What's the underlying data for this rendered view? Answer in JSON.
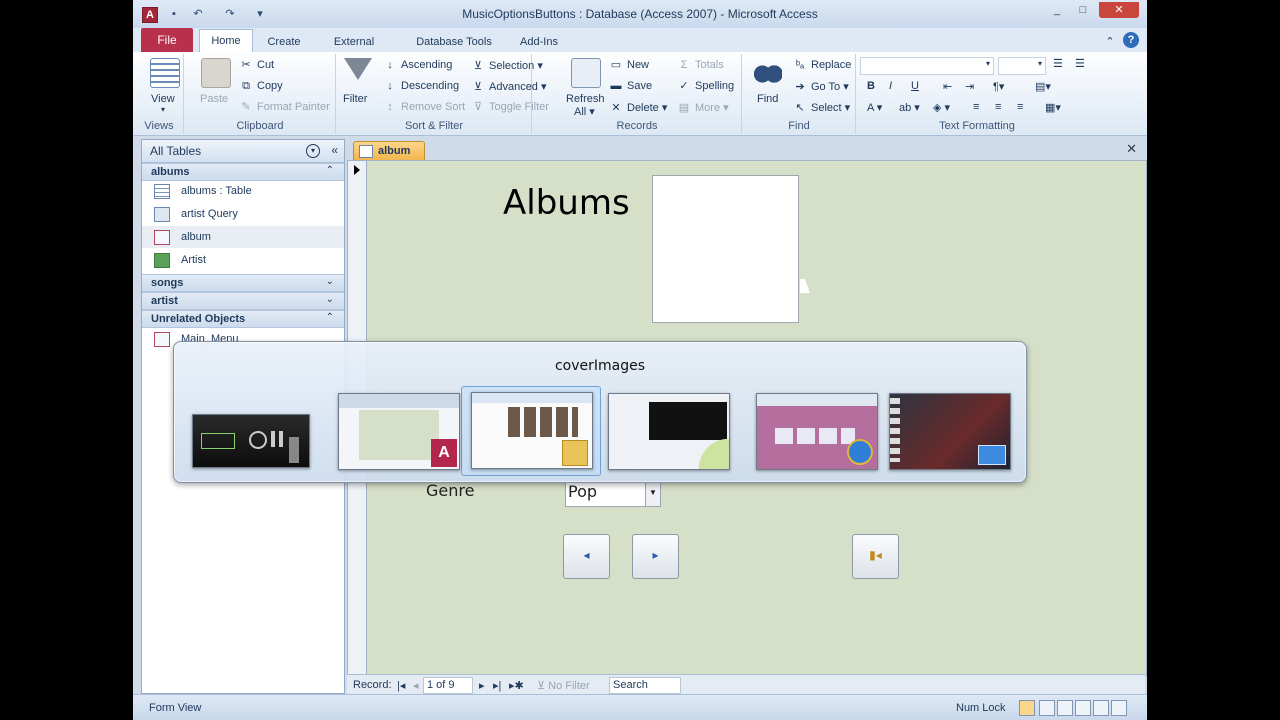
{
  "window": {
    "title": "MusicOptionsButtons : Database (Access 2007) - Microsoft Access",
    "app_letter": "A",
    "controls": [
      "_",
      "□",
      "✕"
    ]
  },
  "tabs": {
    "file": "File",
    "items": [
      "Home",
      "Create",
      "External Data",
      "Database Tools",
      "Add-Ins"
    ],
    "active": "Home"
  },
  "ribbon": {
    "views": {
      "view": "View",
      "label": "Views"
    },
    "clipboard": {
      "paste": "Paste",
      "cut": "Cut",
      "copy": "Copy",
      "format_painter": "Format Painter",
      "label": "Clipboard"
    },
    "sort_filter": {
      "filter": "Filter",
      "ascending": "Ascending",
      "descending": "Descending",
      "remove_sort": "Remove Sort",
      "selection": "Selection",
      "advanced": "Advanced",
      "toggle_filter": "Toggle Filter",
      "label": "Sort & Filter"
    },
    "records": {
      "refresh": "Refresh",
      "refresh_sub": "All",
      "new": "New",
      "save": "Save",
      "delete": "Delete",
      "totals": "Totals",
      "spelling": "Spelling",
      "more": "More",
      "label": "Records"
    },
    "find": {
      "find": "Find",
      "replace": "Replace",
      "goto": "Go To",
      "select": "Select",
      "label": "Find"
    },
    "text_formatting": {
      "bold": "B",
      "italic": "I",
      "underline": "U",
      "label": "Text Formatting"
    }
  },
  "nav_pane": {
    "header": "All Tables",
    "sections": [
      {
        "title": "albums",
        "items": [
          {
            "label": "albums : Table",
            "icon": "table-icon"
          },
          {
            "label": "artist Query",
            "icon": "query-icon"
          },
          {
            "label": "album",
            "icon": "form-icon"
          },
          {
            "label": "Artist",
            "icon": "report-icon"
          }
        ]
      },
      {
        "title": "songs"
      },
      {
        "title": "artist"
      },
      {
        "title": "Unrelated Objects",
        "items": [
          {
            "label": "Main_Menu",
            "icon": "form-icon"
          }
        ]
      }
    ]
  },
  "document": {
    "tab": "album",
    "form_title": "Albums",
    "genre_label": "Genre",
    "genre_value": "Pop"
  },
  "record_nav": {
    "record_label": "Record:",
    "position": "1 of 9",
    "no_filter": "No Filter",
    "search": "Search"
  },
  "status_bar": {
    "left": "Form View",
    "num_lock": "Num Lock"
  },
  "switcher": {
    "title": "coverImages",
    "selected_index": 2
  },
  "colors": {
    "file_tab": "#b9304a",
    "form_bg": "#d6dfc8",
    "doc_tab": "#f2b349"
  }
}
